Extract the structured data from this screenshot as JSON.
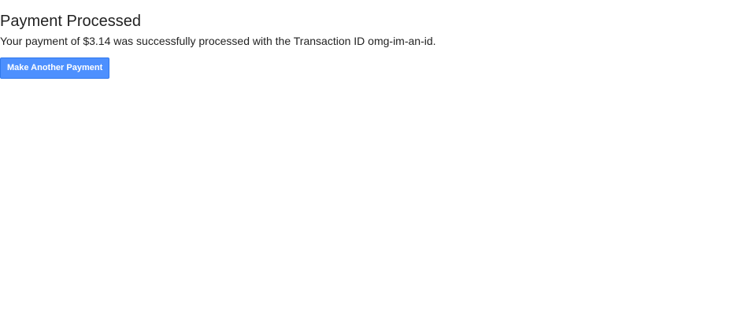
{
  "page": {
    "title": "Payment Processed",
    "message": "Your payment of $3.14 was successfully processed with the Transaction ID omg-im-an-id."
  },
  "actions": {
    "make_another_payment_label": "Make Another Payment"
  },
  "colors": {
    "button_background": "#4d90fe",
    "button_border": "#3079ed",
    "text": "#222222",
    "background": "#ffffff"
  }
}
